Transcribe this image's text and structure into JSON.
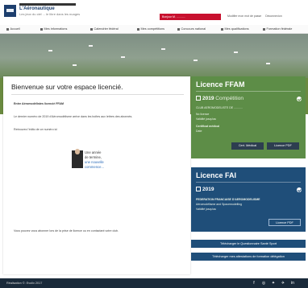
{
  "header": {
    "org_name": "L'Aéronautique",
    "org_sub": "Les jeux du ciel ... le libre dans les nuages",
    "user_button": "Bonjour M. ...........",
    "top_links": [
      "Modifier mon mot de passe",
      "Déconnexion"
    ]
  },
  "nav": {
    "items": [
      {
        "label": "Accueil",
        "icon": "home-icon"
      },
      {
        "label": "Mes informations",
        "icon": "user-icon"
      },
      {
        "label": "Calendrier fédéral",
        "icon": "calendar-icon"
      },
      {
        "label": "Mes compétitions",
        "icon": "trophy-icon"
      },
      {
        "label": "Concours national",
        "icon": "flag-icon"
      },
      {
        "label": "Mes qualifications",
        "icon": "badge-icon"
      },
      {
        "label": "Formation fédérale",
        "icon": "book-icon"
      }
    ]
  },
  "welcome": {
    "title": "Bienvenue sur votre espace licencié.",
    "club_line": "Entre Aéromodélistes licencié FFAM",
    "line_2": "Le dernier numéro de 2019 d'Aéromodélisme arrive dans les boîtes aux lettres des abonnés.",
    "line_3": "Retrouvez l'édito de ce numéro ici",
    "promo": {
      "line1": "Une année",
      "line2": "de termine,",
      "line3": "une nouvelle",
      "line4": "commence..."
    },
    "footer_note": "Vous pouvez vous abonner lors de la prise de licence ou en contactant votre club."
  },
  "license_ffam": {
    "title": "Licence FFAM",
    "year": "2019",
    "category": "Compétition",
    "club": "CLUB AEROMODELISTE DE ...........",
    "numero_label": "No licence",
    "valid_label": "Validité jusqu'au",
    "cert_label": "Certificat médical",
    "date_label": "Date",
    "button_medical": "Cert. Médical",
    "button_pdf": "Licence PDF"
  },
  "license_fai": {
    "title": "Licence FAI",
    "year": "2019",
    "federation": "FEDERATION FRANCAISE D'AEROMODELISME",
    "discipline": "Aéromodélisme and Spacemodelling",
    "valid_label": "Validité jusqu'au",
    "button_pdf": "Licence PDF"
  },
  "downloads": {
    "questionnaire": "Télécharger le Questionnaire Santé Sport",
    "attestation": "Télécharger mes attestations de formation délégation"
  },
  "footer": {
    "text": "Réalisation ©: Evolix 2017",
    "social": [
      "facebook-icon",
      "instagram-icon",
      "twitter-icon",
      "airplane-icon",
      "linkedin-icon"
    ]
  },
  "colors": {
    "ffam_green": "#5d8d47",
    "fai_blue": "#1f4e79",
    "header_red": "#c8102e",
    "footer": "#1a2a3a"
  }
}
